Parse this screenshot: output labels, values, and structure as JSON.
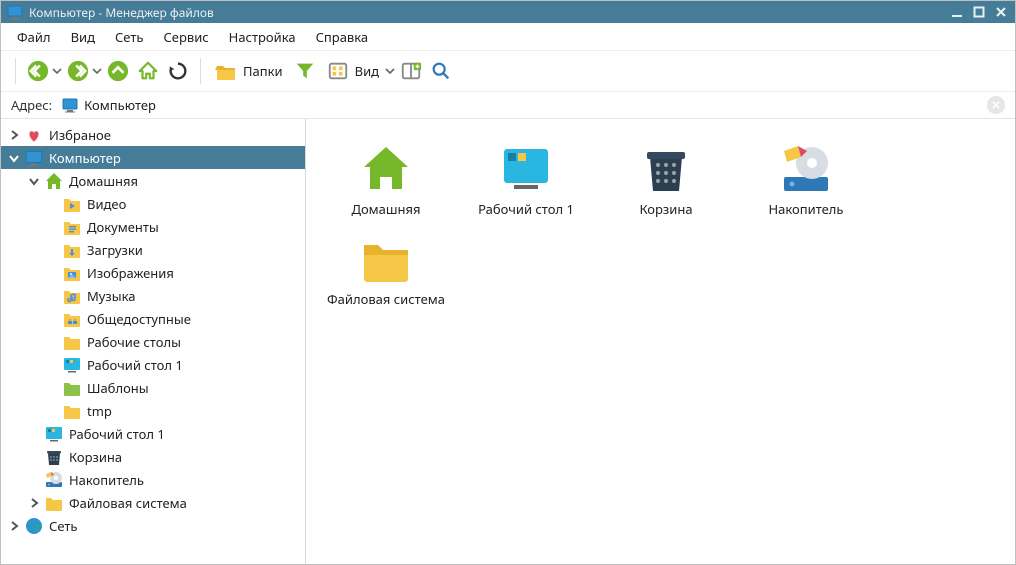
{
  "window": {
    "title": "Компьютер  -  Менеджер файлов"
  },
  "menu": {
    "file": "Файл",
    "view": "Вид",
    "network": "Сеть",
    "service": "Сервис",
    "settings": "Настройка",
    "help": "Справка"
  },
  "toolbar": {
    "folders": "Папки",
    "view": "Вид"
  },
  "address": {
    "label": "Адрес:",
    "path": "Компьютер"
  },
  "tree": {
    "favorites": "Избраное",
    "computer": "Компьютер",
    "home": "Домашняя",
    "videos": "Видео",
    "documents": "Документы",
    "downloads": "Загрузки",
    "pictures": "Изображения",
    "music": "Музыка",
    "public_": "Общедоступные",
    "desktops": "Рабочие столы",
    "desktop1": "Рабочий стол 1",
    "templates": "Шаблоны",
    "tmp": "tmp",
    "desktop1b": "Рабочий стол 1",
    "trash": "Корзина",
    "drive": "Накопитель",
    "filesystem": "Файловая система",
    "network": "Сеть"
  },
  "items": {
    "home": "Домашняя",
    "desktop1": "Рабочий стол 1",
    "trash": "Корзина",
    "drive": "Накопитель",
    "filesystem": "Файловая система"
  }
}
